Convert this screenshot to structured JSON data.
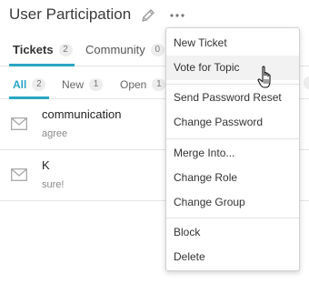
{
  "header": {
    "title": "User Participation",
    "edit_icon": "pencil-icon",
    "more_icon": "ellipsis-icon"
  },
  "tabs": [
    {
      "label": "Tickets",
      "count": "2",
      "active": true
    },
    {
      "label": "Community",
      "count": "0",
      "active": false
    }
  ],
  "filters": [
    {
      "label": "All",
      "count": "2",
      "active": true
    },
    {
      "label": "New",
      "count": "1",
      "active": false
    },
    {
      "label": "Open",
      "count": "1",
      "active": false
    }
  ],
  "tickets": [
    {
      "title": "communication",
      "snippet": "agree",
      "icon": "envelope-icon"
    },
    {
      "title": "K",
      "snippet": "sure!",
      "icon": "envelope-icon"
    }
  ],
  "menu": {
    "groups": [
      [
        "New Ticket",
        "Vote for Topic"
      ],
      [
        "Send Password Reset",
        "Change Password"
      ],
      [
        "Merge Into...",
        "Change Role",
        "Change Group"
      ],
      [
        "Block",
        "Delete"
      ]
    ],
    "hovered": "Vote for Topic"
  },
  "colors": {
    "accent": "#2aa6c4",
    "badge_bg": "#ededed",
    "divider": "#e4e4e4"
  }
}
